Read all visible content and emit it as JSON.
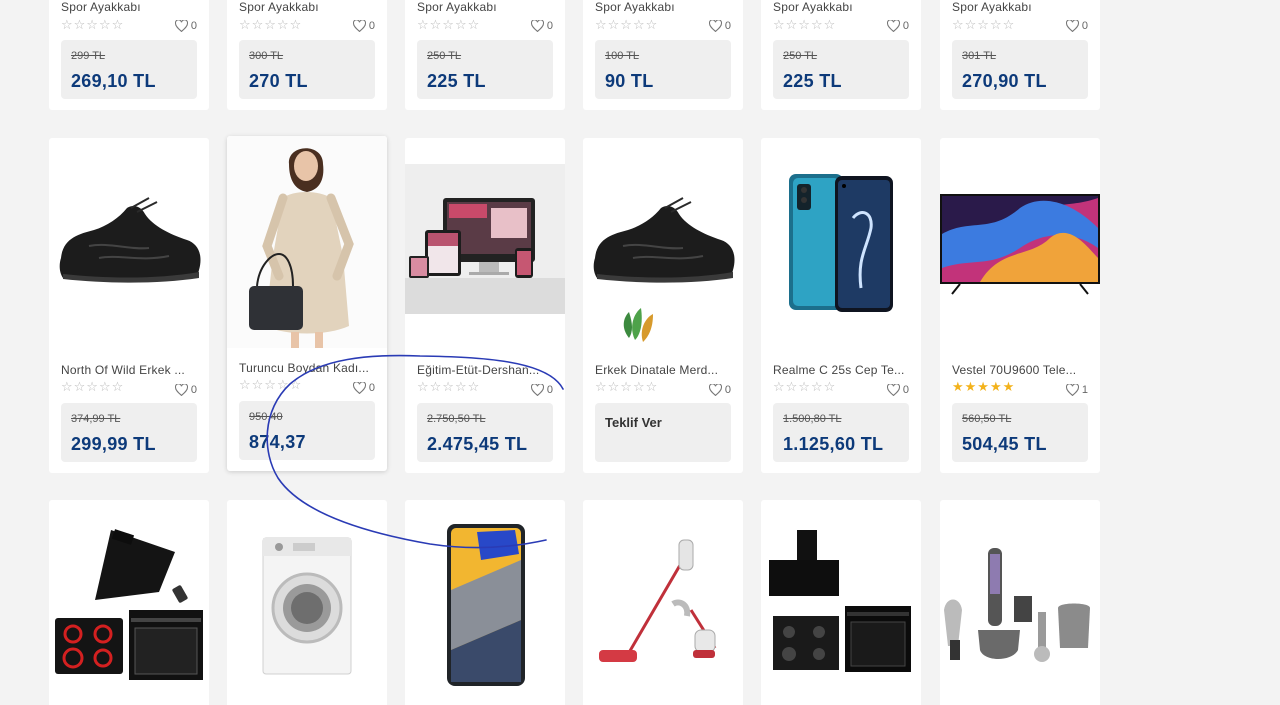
{
  "top_row": [
    {
      "name": "Spor Ayakkabı",
      "stars": "☆☆☆☆☆",
      "favorites": "0",
      "old_price": "299 TL",
      "price": "269,10 TL"
    },
    {
      "name": "Spor Ayakkabı",
      "stars": "☆☆☆☆☆",
      "favorites": "0",
      "old_price": "300 TL",
      "price": "270 TL"
    },
    {
      "name": "Spor Ayakkabı",
      "stars": "☆☆☆☆☆",
      "favorites": "0",
      "old_price": "250 TL",
      "price": "225 TL"
    },
    {
      "name": "Spor Ayakkabı",
      "stars": "☆☆☆☆☆",
      "favorites": "0",
      "old_price": "100 TL",
      "price": "90 TL"
    },
    {
      "name": "Spor Ayakkabı",
      "stars": "☆☆☆☆☆",
      "favorites": "0",
      "old_price": "250 TL",
      "price": "225 TL"
    },
    {
      "name": "Spor Ayakkabı",
      "stars": "☆☆☆☆☆",
      "favorites": "0",
      "old_price": "301 TL",
      "price": "270,90 TL"
    }
  ],
  "middle_row": [
    {
      "name": "North Of Wild Erkek ...",
      "stars": "☆☆☆☆☆",
      "favorites": "0",
      "old_price": "374,99 TL",
      "price": "299,99 TL",
      "image": "black-sneaker"
    },
    {
      "name": "Turuncu Boydan Kadı...",
      "stars": "☆☆☆☆☆",
      "favorites": "0",
      "old_price": "950,40",
      "price": "874,37",
      "image": "woman-dress-with-bag"
    },
    {
      "name": "Eğitim-Etüt-Dershan...",
      "stars": "☆☆☆☆☆",
      "favorites": "0",
      "old_price": "2.750,50 TL",
      "price": "2.475,45 TL",
      "image": "responsive-website-devices"
    },
    {
      "name": "Erkek Dinatale Merd...",
      "stars": "☆☆☆☆☆",
      "favorites": "0",
      "offer": "Teklif Ver",
      "image": "black-sneaker"
    },
    {
      "name": "Realme C 25s Cep Te...",
      "stars": "☆☆☆☆☆",
      "favorites": "0",
      "old_price": "1.500,80 TL",
      "price": "1.125,60 TL",
      "image": "blue-smartphone"
    },
    {
      "name": "Vestel 70U9600 Tele...",
      "stars": "★★★★★",
      "favorites": "1",
      "old_price": "560,50 TL",
      "price": "504,45 TL",
      "image": "television"
    }
  ],
  "bottom_row": [
    {
      "image": "hood-hob-oven-set"
    },
    {
      "image": "washing-machine"
    },
    {
      "image": "smartphone"
    },
    {
      "image": "cordless-vacuum"
    },
    {
      "image": "hood-hob-oven-set-black"
    },
    {
      "image": "hand-blender-set"
    }
  ],
  "colors": {
    "price": "#0d3a7a",
    "star_gold": "#f3b21b",
    "star_empty": "#bbbbbb",
    "background": "#f3f3f3",
    "annotation": "#2a3bb5"
  }
}
